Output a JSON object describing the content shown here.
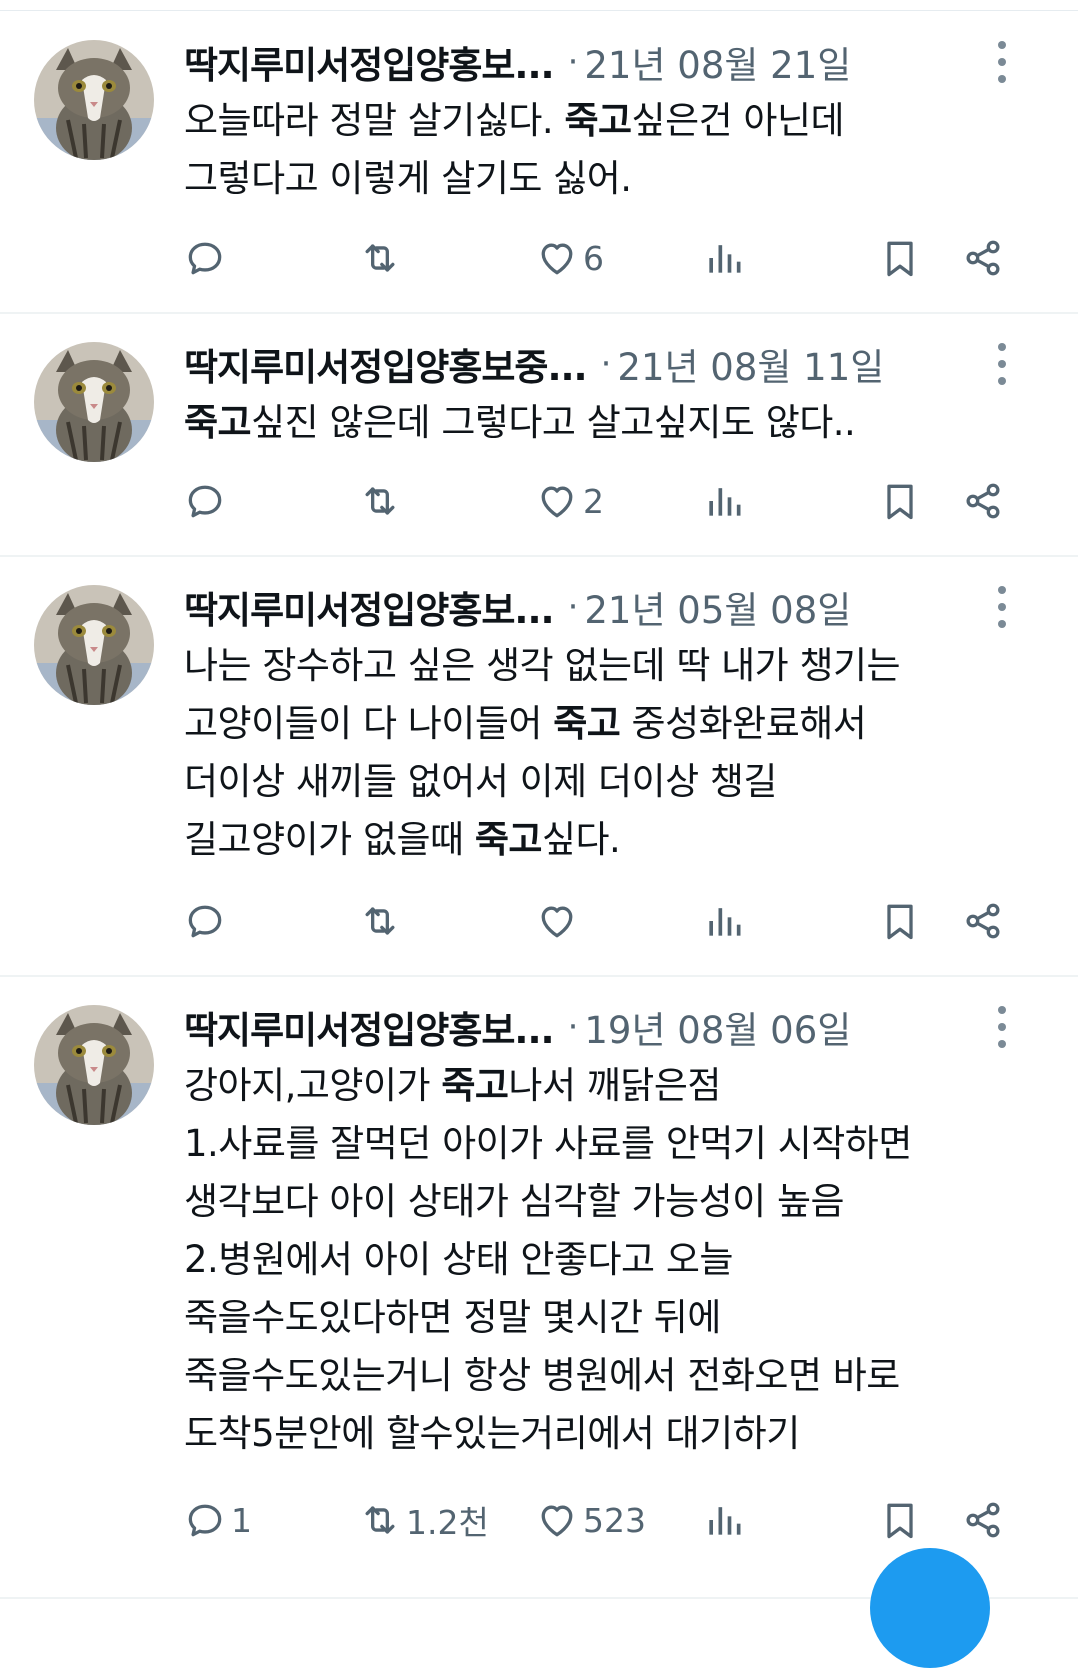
{
  "tweets": [
    {
      "name": "딱지루미서정입양홍보...",
      "separator": "·",
      "date": "21년 08월 21일",
      "lines": [
        [
          {
            "t": "오늘따라 정말 살기싫다. "
          },
          {
            "t": "죽고",
            "b": true
          },
          {
            "t": "싶은건 아닌데"
          }
        ],
        [
          {
            "t": "그렇다고 이렇게 살기도 싫어."
          }
        ]
      ],
      "counts": {
        "reply": "",
        "retweet": "",
        "like": "6"
      }
    },
    {
      "name": "딱지루미서정입양홍보중...",
      "separator": "·",
      "date": "21년 08월 11일",
      "lines": [
        [
          {
            "t": "죽고",
            "b": true
          },
          {
            "t": "싶진 않은데 그렇다고 살고싶지도 않다.."
          }
        ]
      ],
      "counts": {
        "reply": "",
        "retweet": "",
        "like": "2"
      }
    },
    {
      "name": "딱지루미서정입양홍보...",
      "separator": "·",
      "date": "21년 05월 08일",
      "lines": [
        [
          {
            "t": "나는 장수하고 싶은 생각 없는데 딱 내가 챙기는"
          }
        ],
        [
          {
            "t": "고양이들이 다 나이들어 "
          },
          {
            "t": "죽고",
            "b": true
          },
          {
            "t": " 중성화완료해서"
          }
        ],
        [
          {
            "t": "더이상 새끼들 없어서 이제 더이상 챙길"
          }
        ],
        [
          {
            "t": "길고양이가 없을때 "
          },
          {
            "t": "죽고",
            "b": true
          },
          {
            "t": "싶다."
          }
        ]
      ],
      "counts": {
        "reply": "",
        "retweet": "",
        "like": ""
      }
    },
    {
      "name": "딱지루미서정입양홍보...",
      "separator": "·",
      "date": "19년 08월 06일",
      "lines": [
        [
          {
            "t": "강아지,고양이가 "
          },
          {
            "t": "죽고",
            "b": true
          },
          {
            "t": "나서 깨닭은점"
          }
        ],
        [
          {
            "t": "1.사료를 잘먹던 아이가 사료를 안먹기 시작하면"
          }
        ],
        [
          {
            "t": "생각보다 아이 상태가 심각할 가능성이 높음"
          }
        ],
        [
          {
            "t": "2.병원에서 아이 상태 안좋다고 오늘"
          }
        ],
        [
          {
            "t": "죽을수도있다하면 정말 몇시간 뒤에"
          }
        ],
        [
          {
            "t": "죽을수도있는거니 항상 병원에서 전화오면 바로"
          }
        ],
        [
          {
            "t": "도착5분안에 할수있는거리에서 대기하기"
          }
        ]
      ],
      "counts": {
        "reply": "1",
        "retweet": "1.2천",
        "like": "523"
      }
    }
  ],
  "icons": {
    "reply": "reply-icon",
    "retweet": "retweet-icon",
    "like": "heart-icon",
    "views": "views-icon",
    "bookmark": "bookmark-icon",
    "share": "share-icon",
    "more": "more-dots-icon"
  },
  "colors": {
    "muted": "#536471",
    "text": "#0f1419",
    "divider": "#eff3f4",
    "accent": "#1d9bf0"
  }
}
